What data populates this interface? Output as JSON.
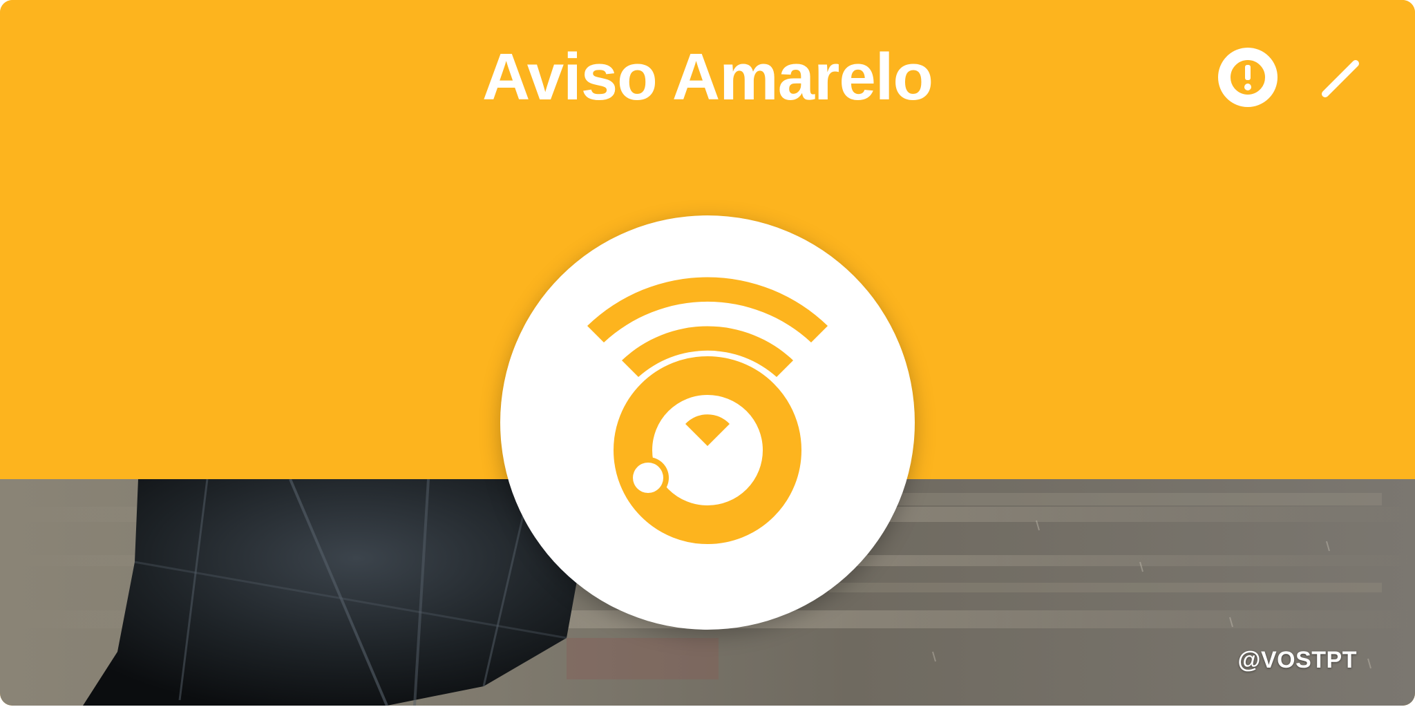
{
  "header": {
    "title": "Aviso Amarelo"
  },
  "actions": {
    "alert_icon": "alert-circle-icon",
    "edit_icon": "edit-pencil-icon"
  },
  "emblem": {
    "icon": "wind-warning-icon"
  },
  "photo": {
    "subject": "umbrella-in-rain"
  },
  "footer": {
    "handle": "@VOSTPT"
  },
  "colors": {
    "accent": "#FDB41E",
    "foreground": "#FFFFFF"
  }
}
